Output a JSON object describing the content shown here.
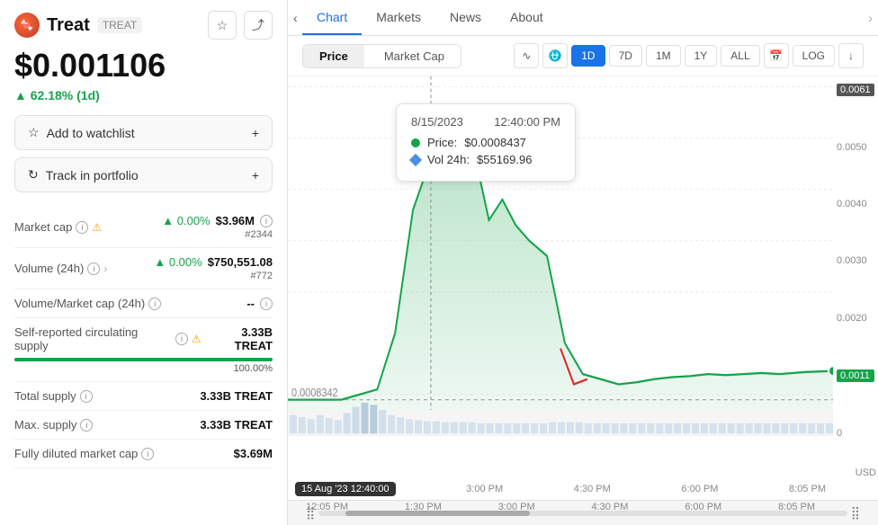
{
  "coin": {
    "name": "Treat",
    "symbol": "TREAT",
    "price": "$0.001106",
    "change": "▲ 62.18% (1d)",
    "logo_text": "🍬"
  },
  "buttons": {
    "add_watchlist": "Add to watchlist",
    "track_portfolio": "Track in portfolio",
    "star_icon": "★",
    "share_icon": "⤴",
    "plus_icon": "+"
  },
  "stats": {
    "market_cap_label": "Market cap",
    "market_cap_change": "▲ 0.00%",
    "market_cap_value": "$3.96M",
    "market_cap_rank": "#2344",
    "volume_label": "Volume (24h)",
    "volume_change": "▲ 0.00%",
    "volume_value": "$750,551.08",
    "volume_rank": "#772",
    "vol_mcap_label": "Volume/Market cap (24h)",
    "vol_mcap_value": "--",
    "supply_label": "Self-reported circulating supply",
    "supply_value": "3.33B TREAT",
    "supply_pct": "100.00%",
    "total_supply_label": "Total supply",
    "total_supply_value": "3.33B TREAT",
    "max_supply_label": "Max. supply",
    "max_supply_value": "3.33B TREAT",
    "fdmc_label": "Fully diluted market cap",
    "fdmc_value": "$3.69M"
  },
  "chart": {
    "tabs": [
      "Chart",
      "Markets",
      "News",
      "About"
    ],
    "active_tab": "Chart",
    "type_btns": [
      "Price",
      "Market Cap"
    ],
    "active_type": "Price",
    "time_btns": [
      "1D",
      "7D",
      "1M",
      "1Y",
      "ALL"
    ],
    "active_time": "1D",
    "log_btn": "LOG",
    "y_labels": [
      "0.0061",
      "0.0050",
      "0.0040",
      "0.0030",
      "0.0020",
      "0.0011",
      "0"
    ],
    "x_labels": [
      "15 Aug '23",
      "12:40:00",
      "3:00 PM",
      "4:30 PM",
      "6:00 PM",
      "8:05 PM"
    ],
    "x_labels_bottom": [
      "12:05 PM",
      "1:30 PM",
      "3:00 PM",
      "4:30 PM",
      "6:00 PM",
      "8:05 PM"
    ],
    "bottom_label_left": "0.0008342",
    "price_right_label": "0.0011",
    "tooltip": {
      "date": "8/15/2023",
      "time": "12:40:00 PM",
      "price_label": "Price:",
      "price_value": "$0.0008437",
      "vol_label": "Vol 24h:",
      "vol_value": "$55169.96"
    },
    "usd_label": "USD"
  }
}
